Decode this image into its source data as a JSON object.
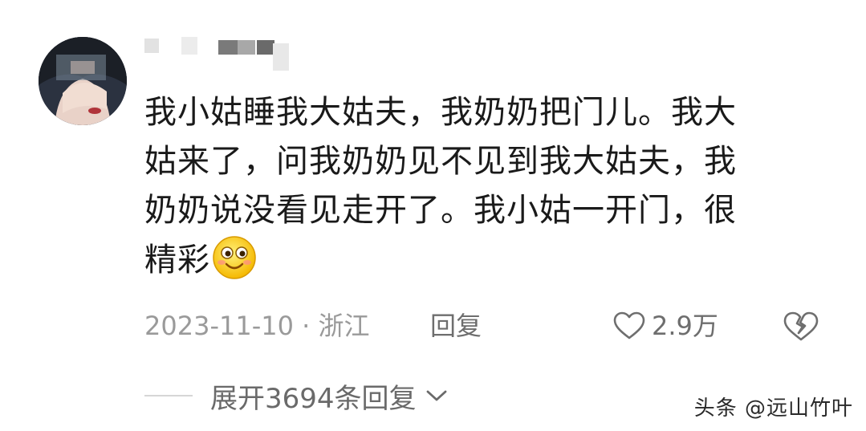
{
  "comment": {
    "lines": [
      "我小姑睡我大姑夫，我奶奶把门儿。我大",
      "姑来了，问我奶奶见不见到我大姑夫，我",
      "奶奶说没看见走开了。我小姑一开门，很",
      "精彩"
    ],
    "emoji_icon": "smiling-face-emoji"
  },
  "meta": {
    "date_location": "2023-11-10 · 浙江",
    "reply_label": "回复",
    "like_count": "2.9万"
  },
  "expand": {
    "label": "展开3694条回复"
  },
  "watermark": "头条 @远山竹叶",
  "colors": {
    "text_primary": "#1a1a1a",
    "text_meta": "#9a9a9a",
    "text_action": "#6e6e6e",
    "divider": "#d6d6d6"
  }
}
